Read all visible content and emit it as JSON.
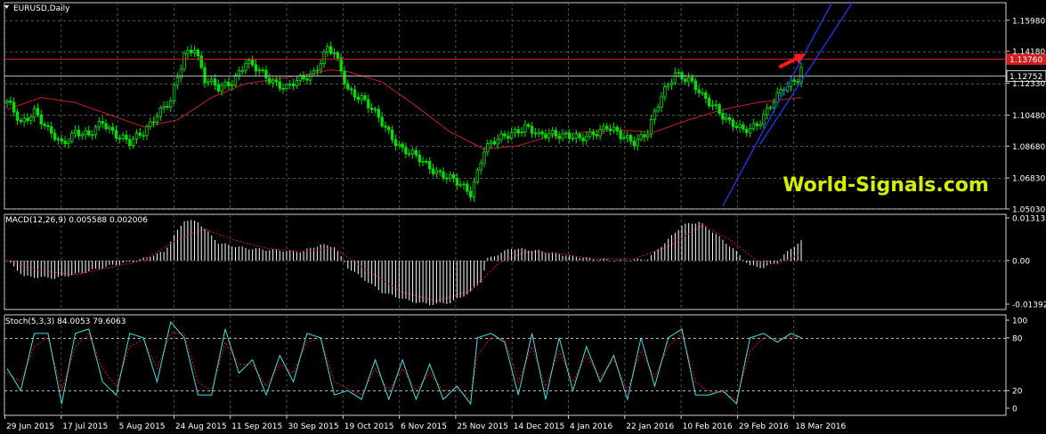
{
  "chart_data": [
    {
      "type": "candlestick",
      "title": "EURUSD,Daily",
      "x_ticks": [
        "29 Jun 2015",
        "17 Jul 2015",
        "5 Aug 2015",
        "24 Aug 2015",
        "11 Sep 2015",
        "30 Sep 2015",
        "19 Oct 2015",
        "6 Nov 2015",
        "25 Nov 2015",
        "14 Dec 2015",
        "4 Jan 2016",
        "22 Jan 2016",
        "10 Feb 2016",
        "29 Feb 2016",
        "18 Mar 2016"
      ],
      "y_ticks": [
        "1.15980",
        "1.14180",
        "1.12330",
        "1.10480",
        "1.08680",
        "1.06830",
        "1.05030"
      ],
      "ylim": [
        1.0503,
        1.17
      ],
      "close_path": [
        [
          0,
          1.112
        ],
        [
          4,
          1.1
        ],
        [
          8,
          1.108
        ],
        [
          12,
          1.095
        ],
        [
          16,
          1.088
        ],
        [
          20,
          1.096
        ],
        [
          24,
          1.092
        ],
        [
          28,
          1.101
        ],
        [
          32,
          1.094
        ],
        [
          36,
          1.088
        ],
        [
          40,
          1.095
        ],
        [
          44,
          1.106
        ],
        [
          48,
          1.112
        ],
        [
          52,
          1.14
        ],
        [
          55,
          1.145
        ],
        [
          58,
          1.125
        ],
        [
          62,
          1.12
        ],
        [
          66,
          1.125
        ],
        [
          70,
          1.135
        ],
        [
          74,
          1.13
        ],
        [
          78,
          1.125
        ],
        [
          82,
          1.12
        ],
        [
          86,
          1.125
        ],
        [
          90,
          1.13
        ],
        [
          94,
          1.143
        ],
        [
          96,
          1.14
        ],
        [
          100,
          1.12
        ],
        [
          104,
          1.115
        ],
        [
          108,
          1.105
        ],
        [
          112,
          1.095
        ],
        [
          116,
          1.085
        ],
        [
          120,
          1.08
        ],
        [
          124,
          1.075
        ],
        [
          128,
          1.07
        ],
        [
          132,
          1.065
        ],
        [
          136,
          1.06
        ],
        [
          140,
          1.085
        ],
        [
          144,
          1.09
        ],
        [
          148,
          1.095
        ],
        [
          152,
          1.098
        ],
        [
          156,
          1.092
        ],
        [
          160,
          1.095
        ],
        [
          164,
          1.093
        ],
        [
          168,
          1.09
        ],
        [
          172,
          1.095
        ],
        [
          176,
          1.098
        ],
        [
          180,
          1.092
        ],
        [
          184,
          1.09
        ],
        [
          188,
          1.095
        ],
        [
          192,
          1.115
        ],
        [
          196,
          1.13
        ],
        [
          200,
          1.125
        ],
        [
          204,
          1.115
        ],
        [
          208,
          1.11
        ],
        [
          212,
          1.1
        ],
        [
          216,
          1.095
        ],
        [
          220,
          1.1
        ],
        [
          224,
          1.11
        ],
        [
          228,
          1.12
        ],
        [
          232,
          1.127
        ],
        [
          233,
          1.133
        ]
      ],
      "candle_count": 234,
      "ma_path": [
        [
          0,
          1.108
        ],
        [
          10,
          1.115
        ],
        [
          20,
          1.112
        ],
        [
          30,
          1.105
        ],
        [
          40,
          1.098
        ],
        [
          50,
          1.102
        ],
        [
          60,
          1.115
        ],
        [
          70,
          1.123
        ],
        [
          80,
          1.126
        ],
        [
          90,
          1.129
        ],
        [
          95,
          1.131
        ],
        [
          100,
          1.13
        ],
        [
          110,
          1.124
        ],
        [
          120,
          1.11
        ],
        [
          130,
          1.095
        ],
        [
          140,
          1.085
        ],
        [
          150,
          1.087
        ],
        [
          160,
          1.093
        ],
        [
          170,
          1.095
        ],
        [
          180,
          1.096
        ],
        [
          190,
          1.095
        ],
        [
          200,
          1.102
        ],
        [
          210,
          1.108
        ],
        [
          220,
          1.112
        ],
        [
          233,
          1.115
        ]
      ],
      "hlines": [
        {
          "value": 1.1376,
          "color": "#c81e1e",
          "label": "1.13760",
          "label_bg": "#d21e1e"
        },
        {
          "value": 1.12752,
          "color": "#b4b4b4",
          "label": "1.12752",
          "label_bg": "#000000"
        }
      ],
      "channel": [
        {
          "from": [
            210,
            1.052
          ],
          "to": [
            242,
            1.17
          ]
        },
        {
          "from": [
            221,
            1.088
          ],
          "to": [
            248,
            1.17
          ]
        }
      ],
      "arrow": {
        "from": [
          227,
          1.133
        ],
        "to": [
          233,
          1.139
        ],
        "color": "#ff1a1a"
      },
      "watermark": "World-Signals.com",
      "colors": {
        "up": "#00e000",
        "down": "#00e000",
        "ma": "#c81e1e",
        "grid": "#505050",
        "axis": "#d0d0d0",
        "text": "#ffffff"
      }
    },
    {
      "type": "bar",
      "title": "MACD(12,26,9) 0.005588 0.002006",
      "y_ticks": [
        "0.013135",
        "0.00",
        "-0.013928"
      ],
      "ylim": [
        -0.013928,
        0.013135
      ],
      "hist_path": [
        [
          0,
          0
        ],
        [
          5,
          -0.0045
        ],
        [
          14,
          -0.005
        ],
        [
          22,
          -0.0035
        ],
        [
          30,
          -0.0015
        ],
        [
          38,
          0.0
        ],
        [
          46,
          0.0025
        ],
        [
          52,
          0.0115
        ],
        [
          56,
          0.011
        ],
        [
          62,
          0.005
        ],
        [
          70,
          0.0035
        ],
        [
          78,
          0.003
        ],
        [
          86,
          0.0025
        ],
        [
          92,
          0.0045
        ],
        [
          96,
          0.004
        ],
        [
          100,
          -0.002
        ],
        [
          110,
          -0.009
        ],
        [
          118,
          -0.0115
        ],
        [
          124,
          -0.0125
        ],
        [
          130,
          -0.012
        ],
        [
          136,
          -0.009
        ],
        [
          139,
          -0.006
        ],
        [
          141,
          0.0005
        ],
        [
          148,
          0.0035
        ],
        [
          156,
          0.0028
        ],
        [
          164,
          0.0015
        ],
        [
          172,
          0.0005
        ],
        [
          180,
          0.0
        ],
        [
          188,
          0.0005
        ],
        [
          194,
          0.006
        ],
        [
          198,
          0.01
        ],
        [
          203,
          0.011
        ],
        [
          208,
          0.0075
        ],
        [
          214,
          0.0025
        ],
        [
          218,
          -0.0015
        ],
        [
          222,
          -0.002
        ],
        [
          226,
          -0.0005
        ],
        [
          230,
          0.0035
        ],
        [
          233,
          0.0055
        ]
      ],
      "signal_path": [
        [
          0,
          0
        ],
        [
          10,
          -0.003
        ],
        [
          20,
          -0.004
        ],
        [
          30,
          -0.002
        ],
        [
          40,
          0.0
        ],
        [
          50,
          0.006
        ],
        [
          58,
          0.009
        ],
        [
          66,
          0.006
        ],
        [
          76,
          0.0035
        ],
        [
          86,
          0.0025
        ],
        [
          96,
          0.0035
        ],
        [
          106,
          -0.003
        ],
        [
          116,
          -0.009
        ],
        [
          126,
          -0.0115
        ],
        [
          136,
          -0.0085
        ],
        [
          144,
          -0.001
        ],
        [
          152,
          0.0025
        ],
        [
          162,
          0.002
        ],
        [
          172,
          0.0005
        ],
        [
          184,
          0.0005
        ],
        [
          194,
          0.004
        ],
        [
          204,
          0.01
        ],
        [
          212,
          0.006
        ],
        [
          220,
          0.0
        ],
        [
          226,
          -0.001
        ],
        [
          233,
          0.002
        ]
      ],
      "colors": {
        "hist": "#ffffff",
        "signal": "#e01010"
      }
    },
    {
      "type": "line",
      "title": "Stoch(5,3,3) 84.0053 79.6063",
      "y_ticks": [
        "100",
        "80",
        "20",
        "0"
      ],
      "ylim": [
        0,
        100
      ],
      "k_path": [
        [
          0,
          45
        ],
        [
          4,
          20
        ],
        [
          8,
          85
        ],
        [
          12,
          85
        ],
        [
          16,
          5
        ],
        [
          20,
          85
        ],
        [
          24,
          90
        ],
        [
          28,
          30
        ],
        [
          32,
          15
        ],
        [
          36,
          85
        ],
        [
          40,
          80
        ],
        [
          44,
          30
        ],
        [
          48,
          98
        ],
        [
          52,
          80
        ],
        [
          56,
          15
        ],
        [
          60,
          15
        ],
        [
          64,
          90
        ],
        [
          68,
          40
        ],
        [
          72,
          55
        ],
        [
          76,
          15
        ],
        [
          80,
          60
        ],
        [
          84,
          30
        ],
        [
          88,
          85
        ],
        [
          92,
          80
        ],
        [
          96,
          15
        ],
        [
          100,
          20
        ],
        [
          104,
          10
        ],
        [
          108,
          55
        ],
        [
          112,
          10
        ],
        [
          116,
          55
        ],
        [
          120,
          10
        ],
        [
          124,
          50
        ],
        [
          128,
          10
        ],
        [
          132,
          25
        ],
        [
          136,
          5
        ],
        [
          138,
          80
        ],
        [
          142,
          85
        ],
        [
          146,
          75
        ],
        [
          150,
          15
        ],
        [
          154,
          85
        ],
        [
          158,
          10
        ],
        [
          162,
          80
        ],
        [
          166,
          20
        ],
        [
          170,
          70
        ],
        [
          174,
          30
        ],
        [
          178,
          60
        ],
        [
          182,
          10
        ],
        [
          186,
          80
        ],
        [
          190,
          25
        ],
        [
          194,
          80
        ],
        [
          198,
          90
        ],
        [
          202,
          15
        ],
        [
          206,
          15
        ],
        [
          210,
          20
        ],
        [
          214,
          5
        ],
        [
          218,
          80
        ],
        [
          222,
          85
        ],
        [
          226,
          75
        ],
        [
          230,
          85
        ],
        [
          233,
          80
        ]
      ],
      "d_path": [
        [
          0,
          40
        ],
        [
          4,
          30
        ],
        [
          8,
          70
        ],
        [
          12,
          80
        ],
        [
          16,
          20
        ],
        [
          20,
          70
        ],
        [
          24,
          85
        ],
        [
          28,
          45
        ],
        [
          32,
          25
        ],
        [
          36,
          70
        ],
        [
          40,
          78
        ],
        [
          44,
          45
        ],
        [
          48,
          85
        ],
        [
          52,
          85
        ],
        [
          56,
          30
        ],
        [
          60,
          20
        ],
        [
          64,
          75
        ],
        [
          68,
          50
        ],
        [
          72,
          50
        ],
        [
          76,
          25
        ],
        [
          80,
          50
        ],
        [
          84,
          40
        ],
        [
          88,
          75
        ],
        [
          92,
          80
        ],
        [
          96,
          30
        ],
        [
          100,
          22
        ],
        [
          104,
          15
        ],
        [
          108,
          45
        ],
        [
          112,
          20
        ],
        [
          116,
          45
        ],
        [
          120,
          20
        ],
        [
          124,
          40
        ],
        [
          128,
          20
        ],
        [
          132,
          22
        ],
        [
          136,
          10
        ],
        [
          138,
          60
        ],
        [
          142,
          80
        ],
        [
          146,
          78
        ],
        [
          150,
          30
        ],
        [
          154,
          70
        ],
        [
          158,
          25
        ],
        [
          162,
          65
        ],
        [
          166,
          30
        ],
        [
          170,
          60
        ],
        [
          174,
          35
        ],
        [
          178,
          55
        ],
        [
          182,
          20
        ],
        [
          186,
          65
        ],
        [
          190,
          35
        ],
        [
          194,
          70
        ],
        [
          198,
          85
        ],
        [
          202,
          30
        ],
        [
          206,
          18
        ],
        [
          210,
          18
        ],
        [
          214,
          10
        ],
        [
          218,
          65
        ],
        [
          222,
          80
        ],
        [
          226,
          78
        ],
        [
          230,
          82
        ],
        [
          233,
          80
        ]
      ],
      "colors": {
        "k": "#40e0e8",
        "d": "#e01010",
        "levels": "#b4b4b4"
      }
    }
  ]
}
